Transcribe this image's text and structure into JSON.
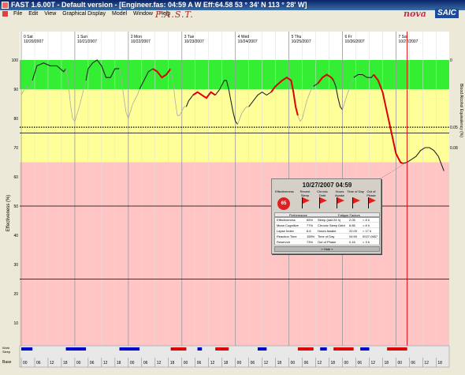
{
  "window": {
    "title": "FAST 1.6.00T - Default version - [Engineer.fas: 04:59 A W Eff:64.58  53 ° 34' N 113 ° 28' W]"
  },
  "menu": [
    "File",
    "Edit",
    "View",
    "Graphical Display",
    "Model",
    "Window",
    "Help"
  ],
  "brand": {
    "fast": "F.A.S.T.",
    "nova": "nova",
    "saic": "SAIC"
  },
  "days": [
    {
      "day": "0 Sat",
      "date": "10/20/2007"
    },
    {
      "day": "1 Sun",
      "date": "10/21/2007"
    },
    {
      "day": "2 Mon",
      "date": "10/22/2007"
    },
    {
      "day": "3 Tue",
      "date": "10/23/2007"
    },
    {
      "day": "4 Wed",
      "date": "10/24/2007"
    },
    {
      "day": "5 Thu",
      "date": "10/25/2007"
    },
    {
      "day": "6 Fr",
      "date": "10/26/2007"
    },
    {
      "day": "7 Sat",
      "date": "10/27/2007"
    }
  ],
  "chart_data": {
    "type": "line",
    "ylabel": "Effectiveness (%)",
    "y2label": "Blood Alcohol Equivalency (%)",
    "ylim": [
      0,
      100
    ],
    "y_ticks": [
      100,
      90,
      80,
      70,
      60,
      50,
      40,
      30,
      20,
      10
    ],
    "y2_ticks": [
      "0",
      "0.05",
      "0.08"
    ],
    "zones": [
      {
        "name": "green",
        "from": 90,
        "to": 100,
        "color": "#33ee33"
      },
      {
        "name": "yellow",
        "from": 65,
        "to": 90,
        "color": "#ffff99"
      },
      {
        "name": "pink",
        "from": 0,
        "to": 65,
        "color": "#ffc4c4"
      }
    ],
    "reference_lines": [
      77,
      75,
      50,
      25
    ],
    "x_unit": "hours from start (0 = 10/20/2007 00:00)",
    "x_tick_labels": [
      "00",
      "06",
      "12",
      "18"
    ],
    "xlim": [
      0,
      189.5
    ],
    "segments": [
      {
        "color": "#aaaaaa",
        "points": [
          [
            0,
            88
          ],
          [
            2,
            91
          ],
          [
            4,
            90
          ],
          [
            5,
            93
          ]
        ]
      },
      {
        "color": "#222222",
        "points": [
          [
            5,
            93
          ],
          [
            7,
            98
          ],
          [
            10,
            99
          ],
          [
            13,
            98
          ],
          [
            16,
            98
          ],
          [
            19,
            96
          ],
          [
            20,
            97
          ]
        ]
      },
      {
        "color": "#aaaaaa",
        "points": [
          [
            20,
            97
          ],
          [
            21,
            93
          ],
          [
            22,
            85
          ],
          [
            23,
            80
          ],
          [
            24,
            79
          ]
        ]
      },
      {
        "color": "#aaaaaa",
        "points": [
          [
            24,
            79
          ],
          [
            26,
            84
          ],
          [
            28,
            90
          ],
          [
            29,
            93
          ]
        ]
      },
      {
        "color": "#222222",
        "points": [
          [
            29,
            93
          ],
          [
            30,
            97
          ],
          [
            32,
            99
          ],
          [
            34,
            100
          ],
          [
            36,
            98
          ],
          [
            38,
            94
          ],
          [
            40,
            94
          ],
          [
            42,
            97
          ],
          [
            44,
            97
          ]
        ]
      },
      {
        "color": "#aaaaaa",
        "points": [
          [
            44,
            97
          ],
          [
            45,
            93
          ],
          [
            46,
            87
          ],
          [
            47,
            82
          ],
          [
            48,
            80
          ]
        ]
      },
      {
        "color": "#aaaaaa",
        "points": [
          [
            48,
            80
          ],
          [
            50,
            85
          ],
          [
            52,
            88
          ],
          [
            53,
            90
          ]
        ]
      },
      {
        "color": "#222222",
        "points": [
          [
            53,
            90
          ],
          [
            55,
            93
          ],
          [
            57,
            96
          ],
          [
            59,
            97
          ]
        ]
      },
      {
        "color": "#dd0000",
        "points": [
          [
            59,
            97
          ],
          [
            61,
            96
          ],
          [
            63,
            94
          ],
          [
            65,
            95
          ],
          [
            67,
            97
          ]
        ]
      },
      {
        "color": "#aaaaaa",
        "points": [
          [
            67,
            97
          ],
          [
            68,
            93
          ],
          [
            69,
            86
          ],
          [
            70,
            81
          ],
          [
            71,
            81
          ]
        ]
      },
      {
        "color": "#aaaaaa",
        "points": [
          [
            71,
            81
          ],
          [
            73,
            84
          ],
          [
            74,
            84
          ]
        ]
      },
      {
        "color": "#222222",
        "points": [
          [
            74,
            84
          ],
          [
            75,
            86
          ],
          [
            77,
            88
          ]
        ]
      },
      {
        "color": "#dd0000",
        "points": [
          [
            77,
            88
          ],
          [
            79,
            89
          ],
          [
            81,
            88
          ],
          [
            83,
            87
          ],
          [
            85,
            89
          ],
          [
            87,
            88
          ]
        ]
      },
      {
        "color": "#222222",
        "points": [
          [
            87,
            88
          ],
          [
            89,
            90
          ],
          [
            91,
            93
          ],
          [
            92,
            93
          ],
          [
            93,
            90
          ],
          [
            94,
            86
          ],
          [
            95,
            82
          ],
          [
            96,
            79
          ],
          [
            97,
            78
          ]
        ]
      },
      {
        "color": "#aaaaaa",
        "points": [
          [
            97,
            78
          ],
          [
            99,
            82
          ],
          [
            101,
            84
          ],
          [
            102,
            84
          ]
        ]
      },
      {
        "color": "#222222",
        "points": [
          [
            102,
            84
          ],
          [
            104,
            86
          ],
          [
            106,
            88
          ],
          [
            108,
            89
          ],
          [
            110,
            88
          ],
          [
            112,
            89
          ]
        ]
      },
      {
        "color": "#dd0000",
        "points": [
          [
            112,
            89
          ],
          [
            114,
            91
          ],
          [
            117,
            93
          ],
          [
            119,
            94
          ],
          [
            121,
            93
          ],
          [
            122,
            89
          ],
          [
            123,
            84
          ],
          [
            124,
            81
          ]
        ]
      },
      {
        "color": "#aaaaaa",
        "points": [
          [
            124,
            81
          ],
          [
            125,
            79
          ],
          [
            126,
            80
          ]
        ]
      },
      {
        "color": "#aaaaaa",
        "points": [
          [
            126,
            80
          ],
          [
            128,
            86
          ],
          [
            130,
            90
          ],
          [
            131,
            91
          ]
        ]
      },
      {
        "color": "#222222",
        "points": [
          [
            131,
            91
          ],
          [
            133,
            92
          ]
        ]
      },
      {
        "color": "#dd0000",
        "points": [
          [
            133,
            92
          ],
          [
            135,
            94
          ],
          [
            137,
            95
          ],
          [
            139,
            94
          ],
          [
            140,
            93
          ]
        ]
      },
      {
        "color": "#222222",
        "points": [
          [
            140,
            93
          ],
          [
            141,
            91
          ],
          [
            142,
            87
          ],
          [
            143,
            84
          ],
          [
            144,
            83
          ]
        ]
      },
      {
        "color": "#aaaaaa",
        "points": [
          [
            144,
            83
          ],
          [
            146,
            88
          ],
          [
            148,
            92
          ],
          [
            149,
            94
          ]
        ]
      },
      {
        "color": "#222222",
        "points": [
          [
            149,
            94
          ],
          [
            151,
            95
          ],
          [
            153,
            95
          ],
          [
            155,
            94
          ],
          [
            157,
            94
          ],
          [
            158,
            95
          ]
        ]
      },
      {
        "color": "#dd0000",
        "points": [
          [
            158,
            95
          ],
          [
            160,
            93
          ],
          [
            162,
            89
          ],
          [
            164,
            82
          ],
          [
            166,
            75
          ],
          [
            168,
            68
          ],
          [
            170,
            65
          ],
          [
            171,
            64.6
          ]
        ]
      },
      {
        "color": "#222222",
        "points": [
          [
            171,
            64.6
          ],
          [
            173,
            65
          ],
          [
            175,
            66
          ],
          [
            177,
            67
          ],
          [
            179,
            69
          ],
          [
            181,
            70
          ],
          [
            183,
            70
          ],
          [
            185,
            69
          ],
          [
            187,
            67
          ],
          [
            189,
            63
          ],
          [
            189.5,
            62
          ]
        ]
      }
    ],
    "cursor_hour": 173,
    "sleep_bars": [
      {
        "color": "#0000cc",
        "from": 0,
        "to": 5
      },
      {
        "color": "#0000cc",
        "from": 20,
        "to": 29
      },
      {
        "color": "#0000cc",
        "from": 44,
        "to": 53
      },
      {
        "color": "#dd0000",
        "from": 67,
        "to": 74
      },
      {
        "color": "#0000cc",
        "from": 79,
        "to": 81
      },
      {
        "color": "#dd0000",
        "from": 87,
        "to": 93
      },
      {
        "color": "#0000cc",
        "from": 106,
        "to": 110
      },
      {
        "color": "#dd0000",
        "from": 124,
        "to": 131
      },
      {
        "color": "#0000cc",
        "from": 134,
        "to": 137
      },
      {
        "color": "#dd0000",
        "from": 140,
        "to": 149
      },
      {
        "color": "#0000cc",
        "from": 152,
        "to": 156
      },
      {
        "color": "#dd0000",
        "from": 164,
        "to": 173
      }
    ]
  },
  "bottom_labels": {
    "work": "Work",
    "sleep": "Sleep",
    "base": "Base"
  },
  "popup": {
    "title": "10/27/2007 04:59",
    "effectiveness_label": "Effectiveness",
    "effectiveness_value": "65",
    "flags": [
      "Recent Sleep",
      "Chronic Debt",
      "Hours Awake",
      "Time of Day",
      "Out of Phase"
    ],
    "table_headers": {
      "performance": "Performance",
      "fatigue": "Fatigue Factors"
    },
    "rows": [
      {
        "name": "Effectiveness",
        "value": "65%",
        "factor": "Sleep (last 24 h)",
        "factor_value": "2.05",
        "extra": "< 8 h"
      },
      {
        "name": "Mean Cognitive",
        "value": "77%",
        "factor": "Chronic Sleep Debt",
        "factor_value": "8.85",
        "extra": "> 8 h"
      },
      {
        "name": "Lapse Index",
        "value": "6.6",
        "factor": "Hours Awake",
        "factor_value": "22.00",
        "extra": "> 17 h"
      },
      {
        "name": "Reaction Time",
        "value": "155%",
        "factor": "Time of Day",
        "factor_value": "04:59",
        "extra": "0027-0657"
      },
      {
        "name": "Reservoir",
        "value": "73%",
        "factor": "Out of Phase",
        "factor_value": "0.16",
        "extra": "< 3 h"
      }
    ],
    "hide_label": "» Hide «"
  }
}
